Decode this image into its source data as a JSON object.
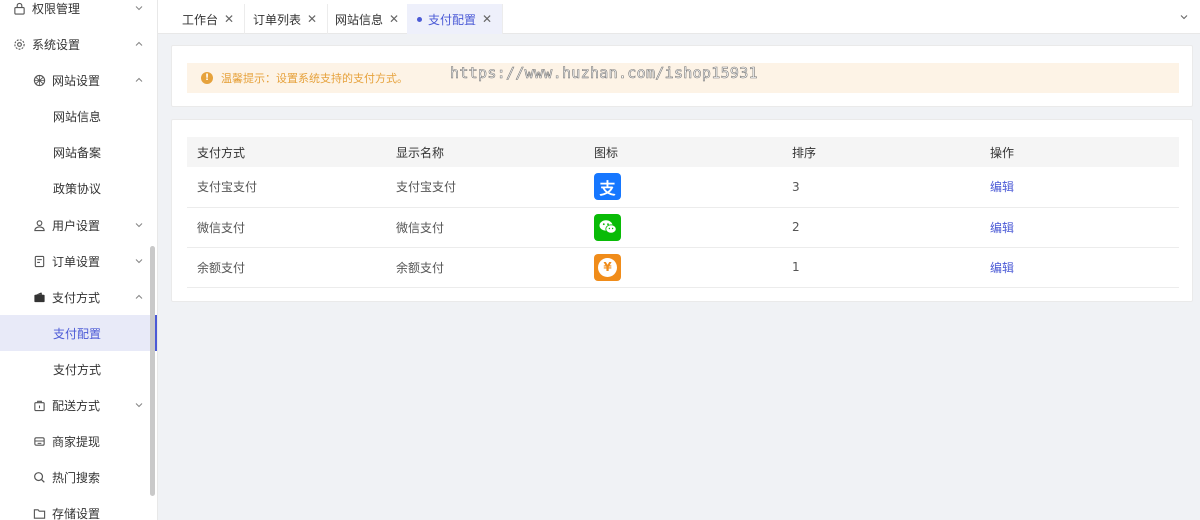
{
  "sidebar": {
    "items": [
      {
        "label": "权限管理",
        "icon": "lock-icon",
        "level": 1,
        "chevron": "down"
      },
      {
        "label": "系统设置",
        "icon": "gear-icon",
        "level": 1,
        "chevron": "up"
      },
      {
        "label": "网站设置",
        "icon": "globe-icon",
        "level": 2,
        "chevron": "up"
      },
      {
        "label": "网站信息",
        "level": 3
      },
      {
        "label": "网站备案",
        "level": 3
      },
      {
        "label": "政策协议",
        "level": 3
      },
      {
        "label": "用户设置",
        "icon": "user-icon",
        "level": 2,
        "chevron": "down"
      },
      {
        "label": "订单设置",
        "icon": "order-icon",
        "level": 2,
        "chevron": "down"
      },
      {
        "label": "支付方式",
        "icon": "wallet-icon",
        "level": 2,
        "chevron": "up"
      },
      {
        "label": "支付配置",
        "level": 3,
        "active": true
      },
      {
        "label": "支付方式",
        "level": 3
      },
      {
        "label": "配送方式",
        "icon": "delivery-icon",
        "level": 2,
        "chevron": "down"
      },
      {
        "label": "商家提现",
        "icon": "withdraw-icon",
        "level": 2
      },
      {
        "label": "热门搜索",
        "icon": "search-icon",
        "level": 2
      },
      {
        "label": "存储设置",
        "icon": "folder-icon",
        "level": 2
      }
    ]
  },
  "tabs": [
    {
      "label": "工作台",
      "active": false
    },
    {
      "label": "订单列表",
      "active": false
    },
    {
      "label": "网站信息",
      "active": false
    },
    {
      "label": "支付配置",
      "active": true
    }
  ],
  "alert": {
    "text": "温馨提示：设置系统支持的支付方式。"
  },
  "watermark": "https://www.huzhan.com/ishop15931",
  "table": {
    "headers": [
      "支付方式",
      "显示名称",
      "图标",
      "排序",
      "操作"
    ],
    "rows": [
      {
        "method": "支付宝支付",
        "display_name": "支付宝支付",
        "icon": "alipay-icon",
        "icon_color": "#1677ff",
        "icon_glyph": "支",
        "sort": "3",
        "action": "编辑"
      },
      {
        "method": "微信支付",
        "display_name": "微信支付",
        "icon": "wechat-icon",
        "icon_color": "#09bb07",
        "icon_glyph": "",
        "sort": "2",
        "action": "编辑"
      },
      {
        "method": "余额支付",
        "display_name": "余额支付",
        "icon": "balance-icon",
        "icon_color": "#f08c1a",
        "icon_glyph": "¥",
        "sort": "1",
        "action": "编辑"
      }
    ]
  },
  "colors": {
    "accent": "#4b5ad6",
    "warning": "#e6a23c",
    "warning_bg": "#fdf3e6"
  }
}
